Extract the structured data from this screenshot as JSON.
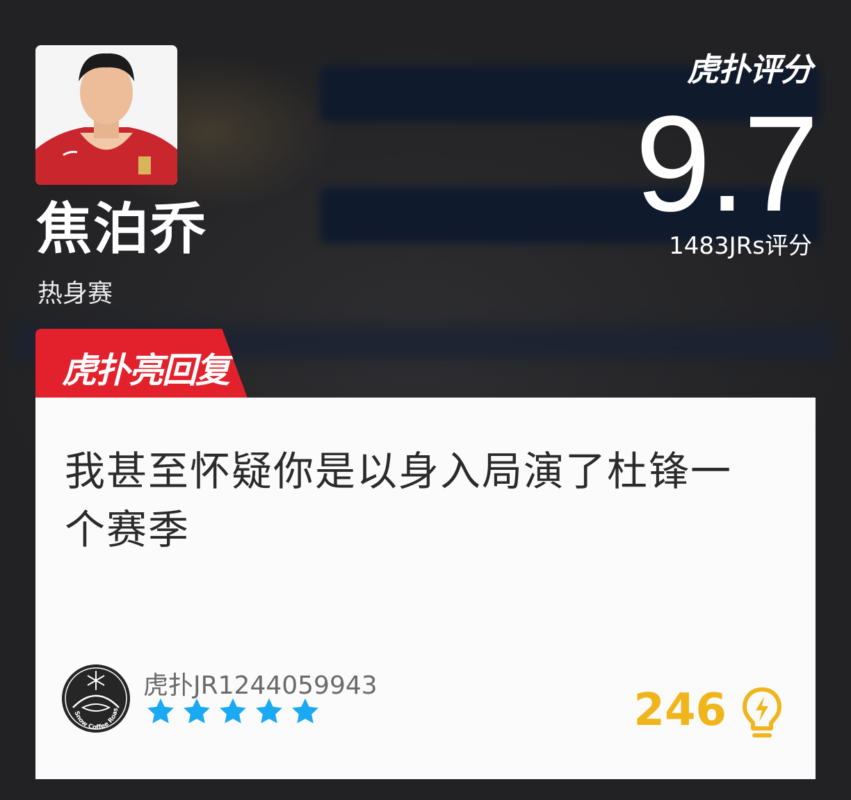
{
  "player": {
    "name": "焦泊乔",
    "game_type": "热身赛"
  },
  "rating": {
    "brand": "虎扑评分",
    "brand_jr": "JR",
    "score": "9.7",
    "count_label": "1483JRs评分"
  },
  "highlight": {
    "tag": "虎扑亮回复",
    "tag_jr": "JR"
  },
  "comment": {
    "text": "我甚至怀疑你是以身入局演了杜锋一个赛季"
  },
  "user": {
    "name": "虎扑JR1244059943",
    "avatar_text": "Snow Coffee Roastery",
    "stars": 5
  },
  "likes": {
    "count": "246"
  },
  "colors": {
    "tag_red": "#e2212c",
    "star_blue": "#1aa9f2",
    "like_gold": "#f1b51c"
  },
  "icons": {
    "snowflake": "snowflake-icon",
    "star": "star-icon",
    "like": "lightbulb-lightning-icon"
  }
}
